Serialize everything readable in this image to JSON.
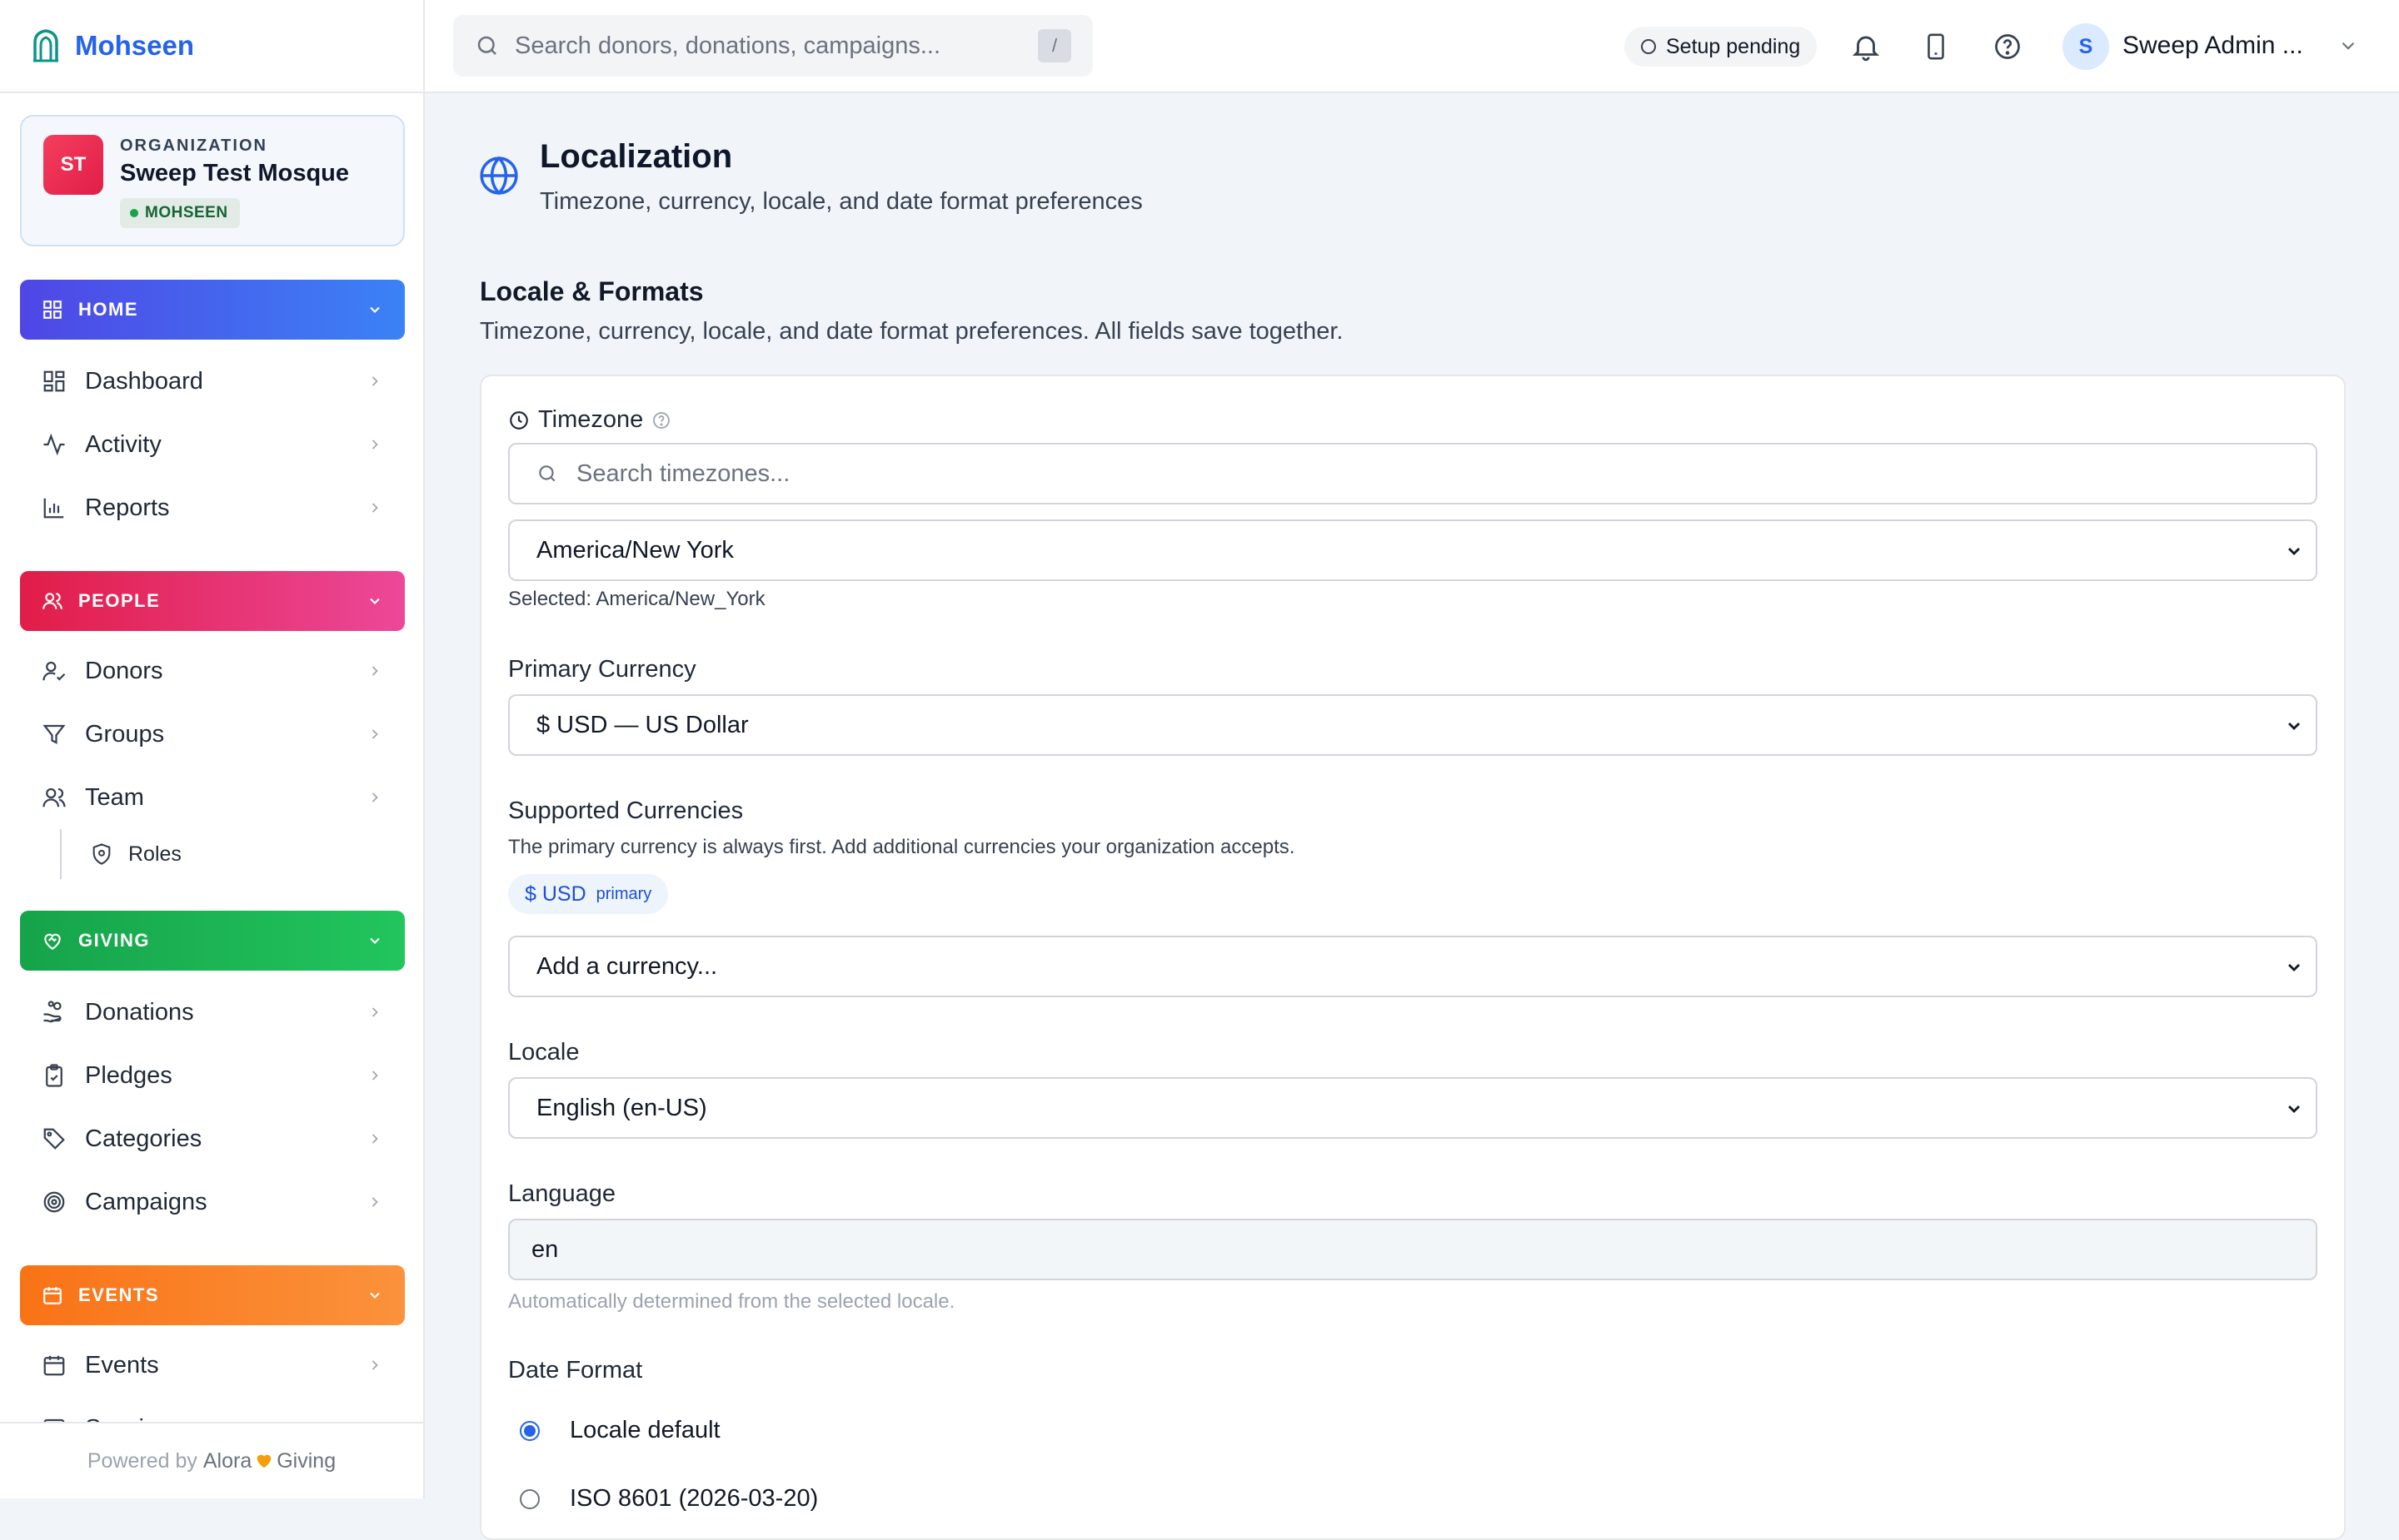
{
  "brand": {
    "name": "Mohseen"
  },
  "org": {
    "initials": "ST",
    "kicker": "ORGANIZATION",
    "name": "Sweep Test Mosque",
    "badge": "MOHSEEN"
  },
  "sidebar": {
    "home": {
      "label": "HOME",
      "items": [
        "Dashboard",
        "Activity",
        "Reports"
      ]
    },
    "people": {
      "label": "PEOPLE",
      "items": [
        "Donors",
        "Groups",
        "Team"
      ],
      "sub": "Roles"
    },
    "giving": {
      "label": "GIVING",
      "items": [
        "Donations",
        "Pledges",
        "Categories",
        "Campaigns"
      ]
    },
    "events": {
      "label": "EVENTS",
      "items": [
        "Events",
        "Sessions"
      ]
    },
    "footer": {
      "prefix": "Powered by",
      "brand1": "Alora",
      "brand2": "Giving"
    }
  },
  "topbar": {
    "search_placeholder": "Search donors, donations, campaigns...",
    "shortcut": "/",
    "setup_status": "Setup pending",
    "user_initial": "S",
    "user_name": "Sweep Admin ..."
  },
  "page": {
    "title": "Localization",
    "subtitle": "Timezone, currency, locale, and date format preferences"
  },
  "section": {
    "title": "Locale & Formats",
    "subtitle": "Timezone, currency, locale, and date format preferences. All fields save together."
  },
  "form": {
    "timezone": {
      "label": "Timezone",
      "search_placeholder": "Search timezones...",
      "value": "America/New York",
      "selected_note": "Selected: America/New_York"
    },
    "primary_currency": {
      "label": "Primary Currency",
      "value": "$ USD — US Dollar"
    },
    "supported_currencies": {
      "label": "Supported Currencies",
      "hint": "The primary currency is always first. Add additional currencies your organization accepts.",
      "chip": "$ USD",
      "chip_tag": "primary",
      "add_placeholder": "Add a currency..."
    },
    "locale": {
      "label": "Locale",
      "value": "English (en-US)"
    },
    "language": {
      "label": "Language",
      "value": "en",
      "hint": "Automatically determined from the selected locale."
    },
    "date_format": {
      "label": "Date Format",
      "options": [
        "Locale default",
        "ISO 8601 (2026-03-20)"
      ],
      "selected": 0
    }
  },
  "colors": {
    "home": "#4f46e5",
    "people": "#e11d48",
    "giving": "#16a34a",
    "events": "#f97316",
    "accent": "#2563eb"
  }
}
